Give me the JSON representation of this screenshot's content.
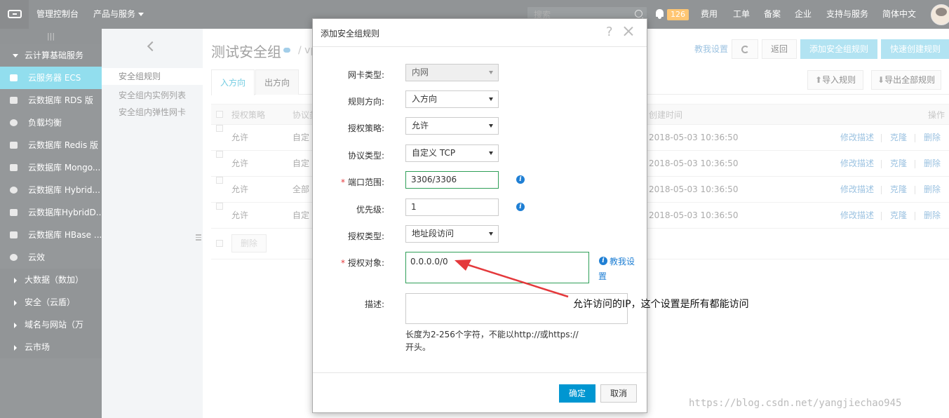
{
  "topbar": {
    "console": "管理控制台",
    "products": "产品与服务",
    "search_placeholder": "搜索",
    "notification_count": "126",
    "links": [
      "费用",
      "工单",
      "备案",
      "企业",
      "支持与服务",
      "简体中文"
    ]
  },
  "sidebar": {
    "toggle": "|||",
    "group_open": "云计算基础服务",
    "items": [
      {
        "label": "云服务器 ECS",
        "icon": "server-icon",
        "active": true
      },
      {
        "label": "云数据库 RDS 版",
        "icon": "database-icon"
      },
      {
        "label": "负载均衡",
        "icon": "load-balancer-icon"
      },
      {
        "label": "云数据库 Redis 版",
        "icon": "redis-icon"
      },
      {
        "label": "云数据库 Mongo...",
        "icon": "mongodb-icon"
      },
      {
        "label": "云数据库 Hybrid...",
        "icon": "hybrid-db-icon"
      },
      {
        "label": "云数据库HybridD...",
        "icon": "hybrid-db2-icon"
      },
      {
        "label": "云数据库 HBase ...",
        "icon": "hbase-icon"
      },
      {
        "label": "云效",
        "icon": "eye-icon"
      }
    ],
    "groups": [
      "大数据（数加）",
      "安全（云盾）",
      "域名与网站（万",
      "云市场"
    ]
  },
  "subnav": {
    "links": [
      "安全组规则",
      "安全组内实例列表",
      "安全组内弹性网卡"
    ]
  },
  "main": {
    "title": "测试安全组",
    "crumb": "/ vp",
    "help_link": "教我设置",
    "buttons": {
      "back": "返回",
      "add_rule": "添加安全组规则",
      "quick_create": "快速创建规则",
      "import": "导入规则",
      "export": "导出全部规则"
    },
    "tabs": [
      "入方向",
      "出方向"
    ],
    "table": {
      "headers": [
        "授权策略",
        "协议类",
        "创建时间",
        "操作"
      ],
      "rows": [
        {
          "policy": "允许",
          "protocol": "自定",
          "created": "2018-05-03 10:36:50"
        },
        {
          "policy": "允许",
          "protocol": "自定",
          "created": "2018-05-03 10:36:50"
        },
        {
          "policy": "允许",
          "protocol": "全部",
          "created": "2018-05-03 10:36:50"
        },
        {
          "policy": "允许",
          "protocol": "自定",
          "created": "2018-05-03 10:36:50"
        }
      ],
      "actions": [
        "修改描述",
        "克隆",
        "删除"
      ],
      "delete_btn": "删除"
    }
  },
  "modal": {
    "title": "添加安全组规则",
    "help": "?",
    "fields": {
      "nic_type": {
        "label": "网卡类型:",
        "value": "内网"
      },
      "direction": {
        "label": "规则方向:",
        "value": "入方向"
      },
      "policy": {
        "label": "授权策略:",
        "value": "允许"
      },
      "protocol": {
        "label": "协议类型:",
        "value": "自定义 TCP"
      },
      "port": {
        "label": "端口范围:",
        "value": "3306/3306"
      },
      "priority": {
        "label": "优先级:",
        "value": "1"
      },
      "auth_type": {
        "label": "授权类型:",
        "value": "地址段访问"
      },
      "auth_object": {
        "label": "授权对象:",
        "value": "0.0.0.0/0",
        "help_a": "教我设",
        "help_b": "置"
      },
      "desc": {
        "label": "描述:",
        "value": "",
        "hint": "长度为2-256个字符，不能以http://或https://开头。"
      }
    },
    "required_mark": "*",
    "info_glyph": "i",
    "ok": "确定",
    "cancel": "取消"
  },
  "annotation": "允许访问的IP，这个设置是所有都能访问",
  "watermark": "https://blog.csdn.net/yangjiechao945",
  "colors": {
    "accent": "#39c4e0",
    "primary_btn": "#0096d1",
    "arrow": "#e4393c",
    "field_ok": "#2f9f58"
  }
}
